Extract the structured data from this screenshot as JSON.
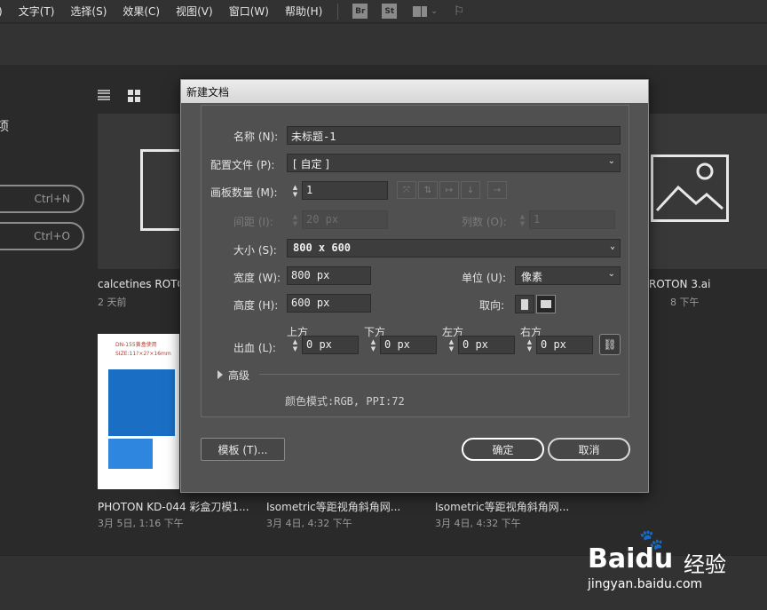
{
  "menubar": {
    "items": [
      ")",
      "文字(T)",
      "选择(S)",
      "效果(C)",
      "视图(V)",
      "窗口(W)",
      "帮助(H)"
    ],
    "badges": [
      "Br",
      "St"
    ],
    "icons": [
      "workspace-icon",
      "broadcast-icon"
    ]
  },
  "start": {
    "title": "项",
    "buttons": {
      "new": "Ctrl+N",
      "open": "Ctrl+O"
    },
    "files": [
      {
        "name": "calcetines ROTO",
        "meta": "2 天前"
      },
      {
        "name": "ROTON 3.ai",
        "meta": "8 下午"
      },
      {
        "name": "PHOTON KD-044 彩盒刀模1...",
        "meta": "3月 5日, 1:16 下午"
      },
      {
        "name": "Isometric等距视角斜角网...",
        "meta": "3月 4日, 4:32 下午"
      },
      {
        "name": "Isometric等距视角斜角网...",
        "meta": "3月 4日, 4:32 下午"
      }
    ],
    "photo_thumb_text": [
      "DN-155黄盒使用",
      "SIZE:11?×2?×16mm"
    ]
  },
  "dialog": {
    "title": "新建文档",
    "name_label": "名称 (N):",
    "name_value": "未标题-1",
    "profile_label": "配置文件 (P):",
    "profile_value": "[ 自定 ]",
    "artboards_label": "画板数量 (M):",
    "artboards_value": "1",
    "spacing_label": "间距 (I):",
    "spacing_value": "20 px",
    "columns_label": "列数 (O):",
    "columns_value": "1",
    "size_label": "大小 (S):",
    "size_value": "800 x 600",
    "width_label": "宽度 (W):",
    "width_value": "800 px",
    "height_label": "高度 (H):",
    "height_value": "600 px",
    "units_label": "单位 (U):",
    "units_value": "像素",
    "orientation_label": "取向:",
    "bleed_label": "出血 (L):",
    "bleed_top_label": "上方",
    "bleed_bottom_label": "下方",
    "bleed_left_label": "左方",
    "bleed_right_label": "右方",
    "bleed_top": "0 px",
    "bleed_bottom": "0 px",
    "bleed_left": "0 px",
    "bleed_right": "0 px",
    "advanced_label": "高级",
    "color_mode": "颜色模式:RGB, PPI:72",
    "templates_button": "模板 (T)...",
    "ok_button": "确定",
    "cancel_button": "取消"
  },
  "watermark": {
    "brand": "Bai",
    "brand_du": "du",
    "cn": "经验",
    "url": "jingyan.baidu.com"
  }
}
